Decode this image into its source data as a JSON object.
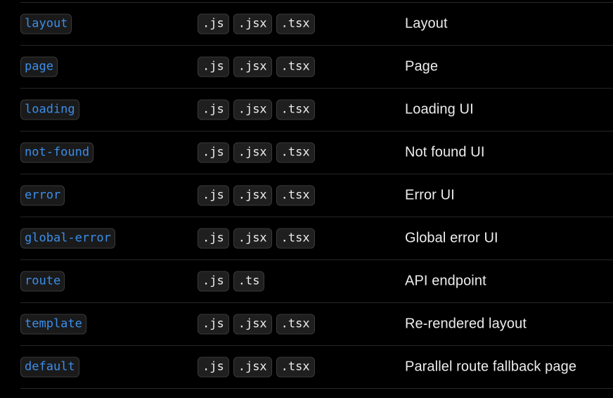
{
  "rows": [
    {
      "name": "layout",
      "exts": [
        ".js",
        ".jsx",
        ".tsx"
      ],
      "description": "Layout"
    },
    {
      "name": "page",
      "exts": [
        ".js",
        ".jsx",
        ".tsx"
      ],
      "description": "Page"
    },
    {
      "name": "loading",
      "exts": [
        ".js",
        ".jsx",
        ".tsx"
      ],
      "description": "Loading UI"
    },
    {
      "name": "not-found",
      "exts": [
        ".js",
        ".jsx",
        ".tsx"
      ],
      "description": "Not found UI"
    },
    {
      "name": "error",
      "exts": [
        ".js",
        ".jsx",
        ".tsx"
      ],
      "description": "Error UI"
    },
    {
      "name": "global-error",
      "exts": [
        ".js",
        ".jsx",
        ".tsx"
      ],
      "description": "Global error UI"
    },
    {
      "name": "route",
      "exts": [
        ".js",
        ".ts"
      ],
      "description": "API endpoint"
    },
    {
      "name": "template",
      "exts": [
        ".js",
        ".jsx",
        ".tsx"
      ],
      "description": "Re-rendered layout"
    },
    {
      "name": "default",
      "exts": [
        ".js",
        ".jsx",
        ".tsx"
      ],
      "description": "Parallel route fallback page"
    }
  ],
  "colors": {
    "background": "#000000",
    "name_text": "#3b8eea",
    "pill_background": "#1f1f1f",
    "pill_border": "#3a3a3a",
    "row_divider": "#262626",
    "description_text": "#ededed"
  }
}
